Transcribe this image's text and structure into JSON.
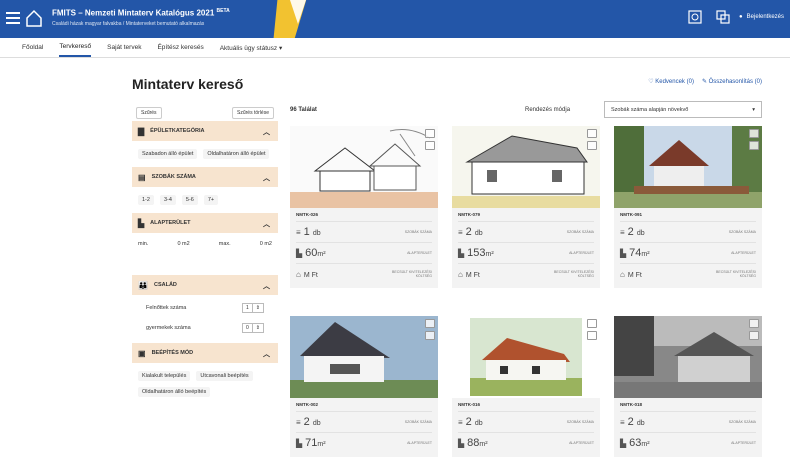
{
  "header": {
    "title": "FMITS – Nemzeti Mintaterv Katalógus 2021",
    "title_badge": "BETA",
    "subtitle": "Családi házak magyar falvakba / Mintaterveket bemutató alkalmazás",
    "user_label": "Bejelentkezés",
    "brand_colors": {
      "primary": "#2356a8",
      "accent": "#f2c230"
    }
  },
  "nav": {
    "items": [
      "Főoldal",
      "Tervkereső",
      "Saját tervek",
      "Építész keresés",
      "Aktuális ügy státusz"
    ]
  },
  "page_title": "Mintaterv kereső",
  "top_links": [
    "♡ Kedvencek (0)",
    "✎ Összehasonlítás (0)"
  ],
  "filters": {
    "search_placeholder": "Szűrés",
    "reset_label": "Szűrés törlése",
    "groups": [
      {
        "title": "ÉPÜLETKATEGÓRIA",
        "icon": "chart-icon",
        "options": [
          "Szabadon álló épület",
          "Oldalhatáron álló épület"
        ]
      },
      {
        "title": "SZOBÁK SZÁMA",
        "icon": "bed-icon",
        "options": [
          "1-2",
          "3-4",
          "5-6",
          "7+"
        ]
      },
      {
        "title": "ALAPTERÜLET",
        "icon": "area-icon",
        "min_label": "min.",
        "max_label": "max.",
        "min_val": "0",
        "max_val": "0",
        "unit": "m2"
      },
      {
        "title": "CSALÁD",
        "icon": "family-icon",
        "rows": [
          {
            "label": "Felnőttek száma",
            "value": "1"
          },
          {
            "label": "gyermekek száma",
            "value": "0"
          }
        ]
      },
      {
        "title": "BEÉPÍTÉS MÓD",
        "icon": "building-icon",
        "options": [
          "Kialakult település",
          "Utcavonali beépítés",
          "Oldalhatáron álló beépítés"
        ]
      }
    ]
  },
  "results": {
    "count_label": "96 Találat",
    "sort_label": "Rendezés módja",
    "sort_value": "Szobák száma alapján növekvő"
  },
  "cards": [
    {
      "code": "NMTK-026",
      "rooms": "1",
      "rooms_unit": "db",
      "rooms_label": "SZOBÁK SZÁMA",
      "area": "60",
      "area_label": "ALAPTERÜLET",
      "price": "M Ft",
      "price_label": "BECSÜLT KIVITELEZÉSI KÖLTSÉG"
    },
    {
      "code": "NMTK-079",
      "rooms": "2",
      "rooms_unit": "db",
      "rooms_label": "SZOBÁK SZÁMA",
      "area": "153",
      "area_label": "ALAPTERÜLET",
      "price": "M Ft",
      "price_label": "BECSÜLT KIVITELEZÉSI KÖLTSÉG"
    },
    {
      "code": "NMTK-091",
      "rooms": "2",
      "rooms_unit": "db",
      "rooms_label": "SZOBÁK SZÁMA",
      "area": "74",
      "area_label": "ALAPTERÜLET",
      "price": "M Ft",
      "price_label": "BECSÜLT KIVITELEZÉSI KÖLTSÉG"
    },
    {
      "code": "NMTK-002",
      "rooms": "2",
      "rooms_unit": "db",
      "rooms_label": "SZOBÁK SZÁMA",
      "area": "71",
      "area_label": "ALAPTERÜLET"
    },
    {
      "code": "NMTK-016",
      "rooms": "2",
      "rooms_unit": "db",
      "rooms_label": "SZOBÁK SZÁMA",
      "area": "88",
      "area_label": "ALAPTERÜLET"
    },
    {
      "code": "NMTK-018",
      "rooms": "2",
      "rooms_unit": "db",
      "rooms_label": "SZOBÁK SZÁMA",
      "area": "63",
      "area_label": "ALAPTERÜLET"
    }
  ],
  "area_unit": "m²",
  "icons": {
    "heart": "heart-icon",
    "compare": "compare-icon",
    "rooms": "rooms-icon",
    "area": "area-icon",
    "price": "house-icon"
  }
}
